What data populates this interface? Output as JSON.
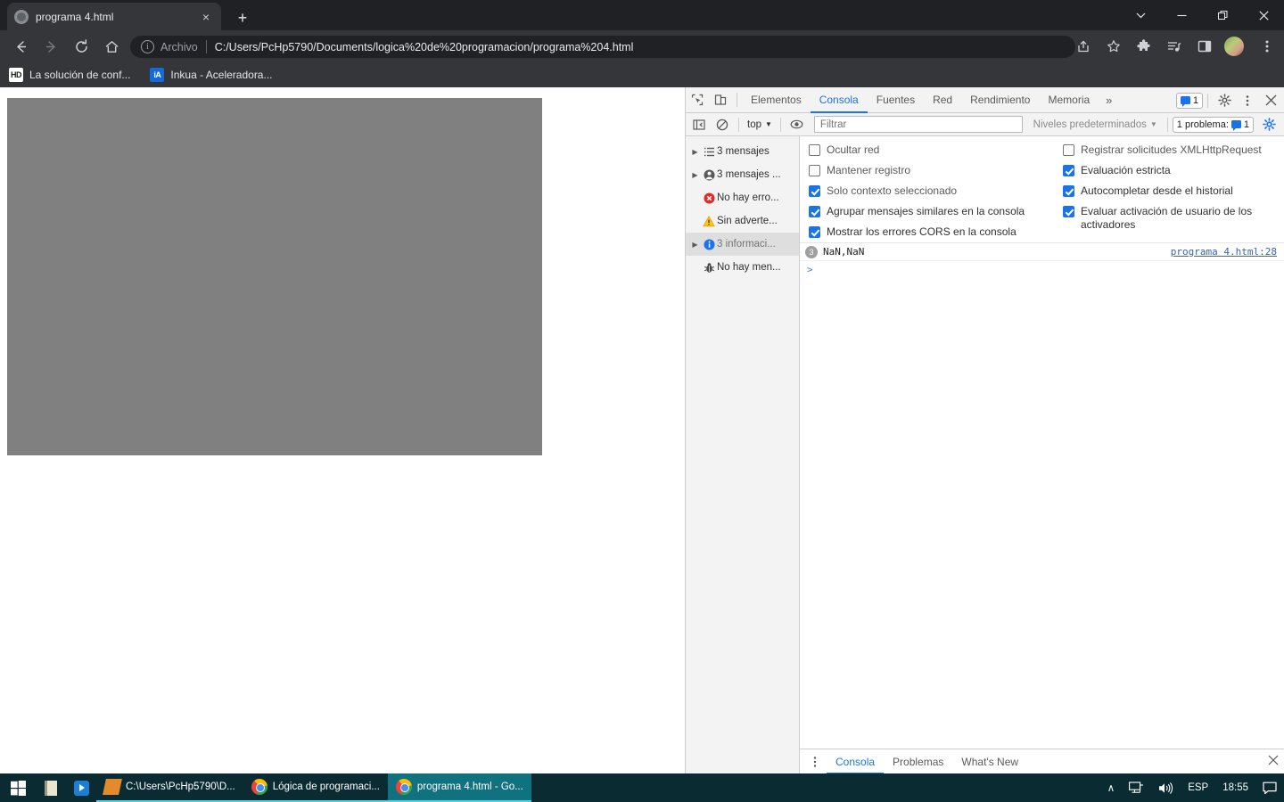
{
  "browser": {
    "tab": {
      "title": "programa 4.html",
      "favicon": "globe-icon",
      "close": "×"
    },
    "new_tab": "+",
    "window_controls": {
      "tab_search": "tab-search-icon",
      "minimize": "minimize-icon",
      "restore": "restore-icon",
      "close": "close-icon"
    },
    "toolbar": {
      "back": "back-arrow-icon",
      "forward": "forward-arrow-icon",
      "reload": "reload-icon",
      "home": "home-icon",
      "scheme_label": "Archivo",
      "url": "C:/Users/PcHp5790/Documents/logica%20de%20programacion/programa%204.html",
      "share": "share-icon",
      "bookmark_star": "star-icon",
      "extensions": "puzzle-icon",
      "media": "media-list-icon",
      "side_panel": "side-panel-icon",
      "profile": "avatar",
      "menu": "three-dot-menu-icon"
    },
    "bookmarks": [
      {
        "badge": "HD",
        "label": "La solución de conf..."
      },
      {
        "badge": "iA",
        "label": "Inkua - Aceleradora..."
      }
    ]
  },
  "devtools": {
    "tabs": [
      {
        "label": "Elementos",
        "active": false
      },
      {
        "label": "Consola",
        "active": true
      },
      {
        "label": "Fuentes",
        "active": false
      },
      {
        "label": "Red",
        "active": false
      },
      {
        "label": "Rendimiento",
        "active": false
      },
      {
        "label": "Memoria",
        "active": false
      }
    ],
    "overflow": "»",
    "message_count_badge": "1",
    "settings_icon": "gear-icon",
    "more_icon": "three-dot-menu-icon",
    "close_icon": "close-icon",
    "inspect_icon": "inspect-element-icon",
    "device_icon": "device-toolbar-icon",
    "filter_bar": {
      "sidebar_toggle": "console-sidebar-toggle-icon",
      "clear_console": "clear-console-icon",
      "context": "top",
      "eye": "live-expression-icon",
      "filter_placeholder": "Filtrar",
      "levels": "Niveles predeterminados",
      "issues_label": "1 problema:",
      "issues_count": "1",
      "settings_gear": "gear-icon"
    },
    "sidebar": [
      {
        "label": "3 mensajes",
        "icon": "list-icon",
        "arrow": true,
        "selected": false,
        "dim": false
      },
      {
        "label": "3 mensajes ...",
        "icon": "user-icon",
        "arrow": true,
        "selected": false,
        "dim": false
      },
      {
        "label": "No hay erro...",
        "icon": "error-icon",
        "arrow": false,
        "selected": false,
        "dim": false
      },
      {
        "label": "Sin adverte...",
        "icon": "warning-icon",
        "arrow": false,
        "selected": false,
        "dim": false
      },
      {
        "label": "3 informaci...",
        "icon": "info-icon",
        "arrow": true,
        "selected": true,
        "dim": true
      },
      {
        "label": "No hay men...",
        "icon": "bug-icon",
        "arrow": false,
        "selected": false,
        "dim": false
      }
    ],
    "settings_left": [
      {
        "label": "Ocultar red",
        "checked": false,
        "dim": true
      },
      {
        "label": "Mantener registro",
        "checked": false,
        "dim": true
      },
      {
        "label": "Solo contexto seleccionado",
        "checked": true,
        "dim": true
      },
      {
        "label": "Agrupar mensajes similares en la consola",
        "checked": true,
        "dim": false
      },
      {
        "label": "Mostrar los errores CORS en la consola",
        "checked": true,
        "dim": false
      }
    ],
    "settings_right": [
      {
        "label": "Registrar solicitudes XMLHttpRequest",
        "checked": false,
        "dim": true
      },
      {
        "label": "Evaluación estricta",
        "checked": true,
        "dim": false
      },
      {
        "label": "Autocompletar desde el historial",
        "checked": true,
        "dim": false
      },
      {
        "label": "Evaluar activación de usuario de los activadores",
        "checked": true,
        "dim": false
      }
    ],
    "console_messages": [
      {
        "count": "3",
        "text": "NaN,NaN",
        "source": "programa 4.html:28"
      }
    ],
    "prompt": ">",
    "drawer_tabs": [
      {
        "label": "Consola",
        "active": true
      },
      {
        "label": "Problemas",
        "active": false
      },
      {
        "label": "What's New",
        "active": false
      }
    ],
    "drawer_menu_icon": "three-dot-menu-icon",
    "drawer_close_icon": "close-icon"
  },
  "taskbar": {
    "start": "windows-start-icon",
    "pinned": [
      {
        "name": "notepad-icon"
      },
      {
        "name": "media-player-icon"
      }
    ],
    "tasks": [
      {
        "label": "C:\\Users\\PcHp5790\\D...",
        "icon": "sublime-text-icon",
        "active": false,
        "open": true
      },
      {
        "label": "Lógica de programaci...",
        "icon": "chrome-icon",
        "active": false,
        "open": true
      },
      {
        "label": "programa 4.html - Go...",
        "icon": "chrome-icon",
        "active": true,
        "open": true
      }
    ],
    "tray": {
      "overflow": "∧",
      "network": "network-icon",
      "volume": "volume-icon",
      "language": "ESP",
      "time": "18:55",
      "notifications": "notification-icon"
    }
  },
  "colors": {
    "chrome_dark": "#35363a",
    "tabstrip": "#202124",
    "accent_blue": "#1a73e8",
    "taskbar": "#0b2b33",
    "taskbar_active": "#11727f",
    "page_block": "#808080"
  }
}
